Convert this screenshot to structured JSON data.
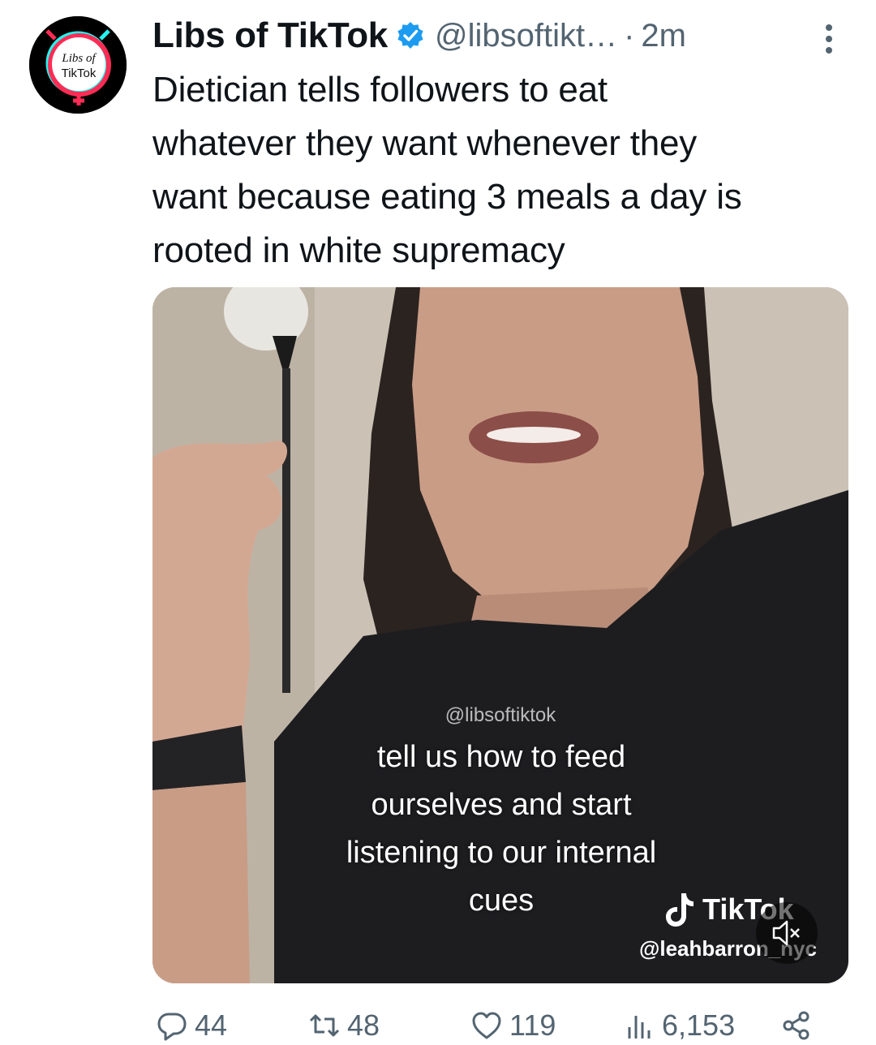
{
  "author": {
    "display_name": "Libs of TikTok",
    "handle": "@libsoftikt…",
    "separator": "·",
    "time": "2m",
    "avatar_text_line1": "Libs of",
    "avatar_text_line2": "TikTok"
  },
  "tweet": {
    "text": "Dietician tells followers to eat\nwhatever they want whenever they\nwant because eating 3 meals a day is\nrooted in white supremacy"
  },
  "media": {
    "watermark": "@libsoftiktok",
    "caption": "tell us how to feed\nourselves and start\nlistening to our internal\ncues",
    "tiktok_brand": "TikTok",
    "tiktok_user": "@leahbarron_nyc"
  },
  "actions": {
    "replies": "44",
    "retweets": "48",
    "likes": "119",
    "views": "6,153"
  },
  "icons": {
    "verified": "verified-badge-icon",
    "more": "more-vertical-icon",
    "reply": "reply-icon",
    "retweet": "retweet-icon",
    "like": "heart-icon",
    "views": "views-chart-icon",
    "share": "share-icon",
    "mute": "muted-speaker-icon"
  },
  "colors": {
    "verified": "#1d9bf0",
    "secondary_text": "#536471"
  }
}
